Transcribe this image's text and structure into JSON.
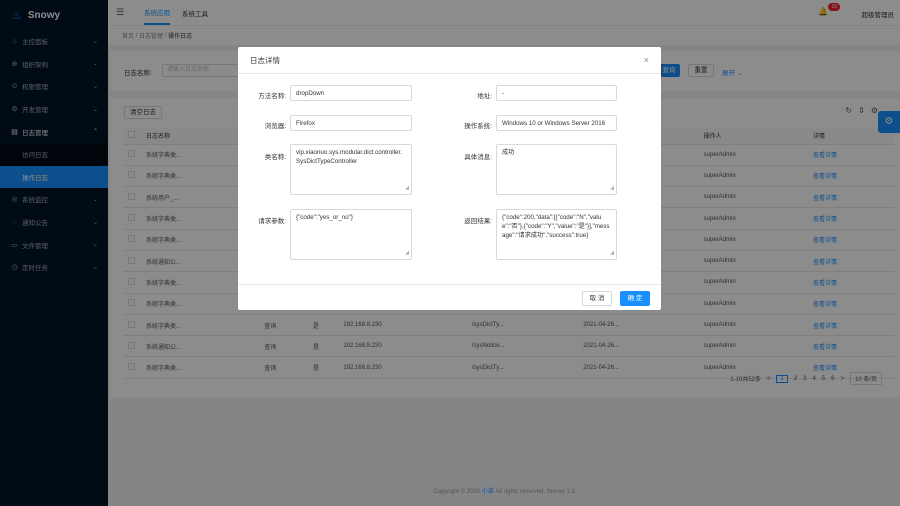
{
  "app": {
    "name": "Snowy"
  },
  "sidebar": {
    "items": [
      {
        "icon": "home-icon",
        "label": "主控面板"
      },
      {
        "icon": "org-icon",
        "label": "组织架构"
      },
      {
        "icon": "lock-icon",
        "label": "权限管理"
      },
      {
        "icon": "dev-icon",
        "label": "开发管理"
      },
      {
        "icon": "log-icon",
        "label": "日志管理"
      }
    ],
    "sub_items": [
      {
        "label": "访问日志"
      },
      {
        "label": "操作日志"
      }
    ],
    "more_items": [
      {
        "icon": "monitor-icon",
        "label": "系统监控"
      },
      {
        "icon": "notice-icon",
        "label": "通知公告"
      },
      {
        "icon": "file-icon",
        "label": "文件管理"
      },
      {
        "icon": "timer-icon",
        "label": "定时任务"
      }
    ]
  },
  "header": {
    "tabs": [
      {
        "label": "系统应用"
      },
      {
        "label": "系统工具"
      }
    ],
    "badge": "10",
    "user": "超级管理员"
  },
  "breadcrumb": {
    "home": "首页",
    "sep": "/",
    "parent": "日志管理",
    "current": "操作日志"
  },
  "search": {
    "label": "日志名称:",
    "placeholder": "请输入日志名称",
    "query": "查询",
    "reset": "重置",
    "expand": "展开"
  },
  "table": {
    "clear_button": "清空日志",
    "columns": [
      "日志名称",
      "",
      "",
      "",
      "",
      "",
      "操作人",
      "详情"
    ],
    "rows": [
      {
        "name": "系统字典类...",
        "type": "",
        "ok": "",
        "ip": "",
        "url": "",
        "time": "",
        "user": "superAdmin",
        "action": "查看详情"
      },
      {
        "name": "系统字典类...",
        "type": "",
        "ok": "",
        "ip": "",
        "url": "",
        "time": "",
        "user": "superAdmin",
        "action": "查看详情"
      },
      {
        "name": "系统用户_...",
        "type": "",
        "ok": "",
        "ip": "",
        "url": "",
        "time": "",
        "user": "superAdmin",
        "action": "查看详情"
      },
      {
        "name": "系统字典类...",
        "type": "",
        "ok": "",
        "ip": "",
        "url": "",
        "time": "",
        "user": "superAdmin",
        "action": "查看详情"
      },
      {
        "name": "系统字典类...",
        "type": "",
        "ok": "",
        "ip": "",
        "url": "",
        "time": "",
        "user": "superAdmin",
        "action": "查看详情"
      },
      {
        "name": "系统通知公...",
        "type": "",
        "ok": "",
        "ip": "",
        "url": "",
        "time": "",
        "user": "superAdmin",
        "action": "查看详情"
      },
      {
        "name": "系统字典类...",
        "type": "",
        "ok": "",
        "ip": "",
        "url": "",
        "time": "",
        "user": "superAdmin",
        "action": "查看详情"
      },
      {
        "name": "系统字典类...",
        "type": "",
        "ok": "",
        "ip": "",
        "url": "",
        "time": "",
        "user": "superAdmin",
        "action": "查看详情"
      },
      {
        "name": "系统字典类...",
        "type": "查询",
        "ok": "是",
        "ip": "192.168.8.230",
        "url": "/sysDictTy...",
        "time": "2021-04-26...",
        "user": "superAdmin",
        "action": "查看详情"
      },
      {
        "name": "系统通知公...",
        "type": "查询",
        "ok": "是",
        "ip": "192.168.8.230",
        "url": "/sysNotice...",
        "time": "2021-04-26...",
        "user": "superAdmin",
        "action": "查看详情"
      },
      {
        "name": "系统字典类...",
        "type": "查询",
        "ok": "是",
        "ip": "192.168.8.230",
        "url": "/sysDictTy...",
        "time": "2021-04-26...",
        "user": "superAdmin",
        "action": "查看详情"
      }
    ]
  },
  "pagination": {
    "total": "1-10共52条",
    "prev": "<",
    "pages": [
      "1",
      "2",
      "3",
      "4",
      "5",
      "6"
    ],
    "next": ">",
    "size": "10 条/页"
  },
  "footer": {
    "text": "Copyright © 2020 ",
    "link": "小诺",
    "rest": " All rights reserved. Snowy 1.3"
  },
  "modal": {
    "title": "日志详情",
    "close": "×",
    "method_label": "方法名称:",
    "method": "dropDown",
    "address_label": "地址:",
    "address": "-",
    "browser_label": "浏览器:",
    "browser": "Firefox",
    "os_label": "操作系统:",
    "os": "Windows 10 or Windows Server 2016",
    "class_label": "类名称:",
    "class_name": "vip.xiaonuo.sys.modular.dict.controller.SysDictTypeController",
    "message_label": "具体消息:",
    "message": "成功",
    "params_label": "请求参数:",
    "params": "{\"code\":\"yes_or_no\"}",
    "result_label": "返回结果:",
    "result": "{\"code\":200,\"data\":[{\"code\":\"N\",\"value\":\"否\"},{\"code\":\"Y\",\"value\":\"是\"}],\"message\":\"请求成功\",\"success\":true}",
    "cancel": "取 消",
    "ok": "确 定"
  },
  "colors": {
    "primary": "#1890ff",
    "sidebar": "#001529",
    "danger": "#f5222d"
  }
}
